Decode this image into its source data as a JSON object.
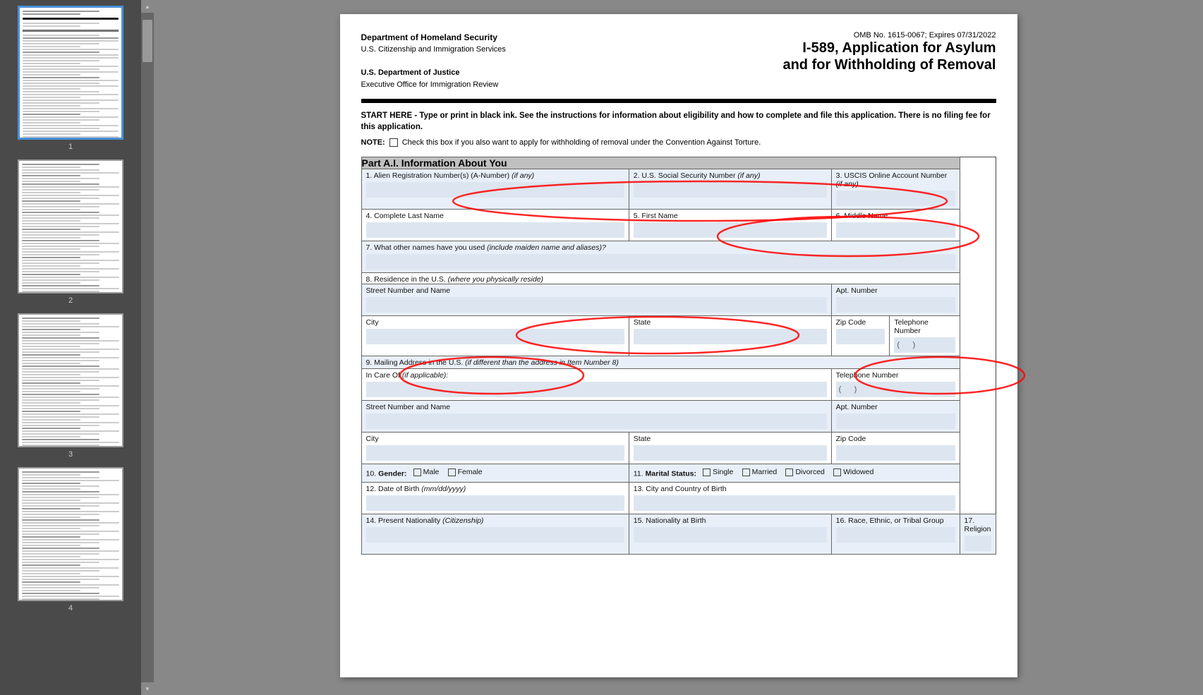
{
  "sidebar": {
    "pages": [
      {
        "id": 1,
        "label": "1",
        "active": true
      },
      {
        "id": 2,
        "label": "2",
        "active": false
      },
      {
        "id": 3,
        "label": "3",
        "active": false
      },
      {
        "id": 4,
        "label": "4",
        "active": false
      }
    ]
  },
  "scrollbar": {
    "up_arrow": "▲",
    "down_arrow": "▼"
  },
  "document": {
    "header_left_line1": "Department of Homeland Security",
    "header_left_line2": "U.S. Citizenship and Immigration Services",
    "header_left_line3": "U.S. Department of Justice",
    "header_left_line4": "Executive Office for Immigration Review",
    "header_right_omb": "OMB No. 1615-0067; Expires 07/31/2022",
    "header_right_title": "I-589, Application for Asylum",
    "header_right_subtitle": "and for Withholding of Removal",
    "start_here_text": "START HERE - Type or print in black ink.  See the instructions for information about eligibility and how to complete and file this application.  There is no filing fee for this application.",
    "note_label": "NOTE:",
    "note_text": "Check this box if you also want to apply for withholding of removal under the Convention Against Torture.",
    "part_a_header": "Part A.I.  Information About You",
    "field1_label": "1. Alien Registration Number(s) (A-Number)",
    "field1_label2": "(if any)",
    "field2_label": "2. U.S. Social Security Number",
    "field2_label2": "(if any)",
    "field3_label": "3. USCIS Online Account Number",
    "field3_label2": "(if any)",
    "field4_label": "4. Complete Last Name",
    "field5_label": "5. First Name",
    "field6_label": "6. Middle Name",
    "field7_label": "7. What other names have you used",
    "field7_label2": "(include maiden name and aliases)?",
    "field8_label": "8. Residence in the U.S.",
    "field8_label2": "(where you physically reside)",
    "street_number_label": "Street Number and Name",
    "apt_number_label": "Apt. Number",
    "city_label": "City",
    "state_label": "State",
    "zip_code_label": "Zip Code",
    "telephone_label": "Telephone Number",
    "telephone_placeholder": "(",
    "telephone_placeholder2": ")",
    "field9_label": "9. Mailing Address in the U.S.",
    "field9_label2": "(if different than the address in Item Number 8)",
    "in_care_of_label": "In Care Of",
    "in_care_of_label2": "(if applicable):",
    "telephone2_label": "Telephone Number",
    "telephone2_ph1": "(",
    "telephone2_ph2": ")",
    "street2_label": "Street Number and Name",
    "apt2_label": "Apt. Number",
    "city2_label": "City",
    "state2_label": "State",
    "zip2_label": "Zip Code",
    "field10_label": "10.",
    "gender_label": "Gender:",
    "male_label": "Male",
    "female_label": "Female",
    "field11_label": "11.",
    "marital_label": "Marital Status:",
    "single_label": "Single",
    "married_label": "Married",
    "divorced_label": "Divorced",
    "widowed_label": "Widowed",
    "field12_label": "12. Date of Birth",
    "field12_label2": "(mm/dd/yyyy)",
    "field13_label": "13. City and Country of Birth",
    "field14_label": "14. Present Nationality",
    "field14_label2": "(Citizenship)",
    "field15_label": "15.",
    "field15_label2": "Nationality at Birth",
    "field16_label": "16. Race, Ethnic, or Tribal Group",
    "field17_label": "17. Religion"
  }
}
